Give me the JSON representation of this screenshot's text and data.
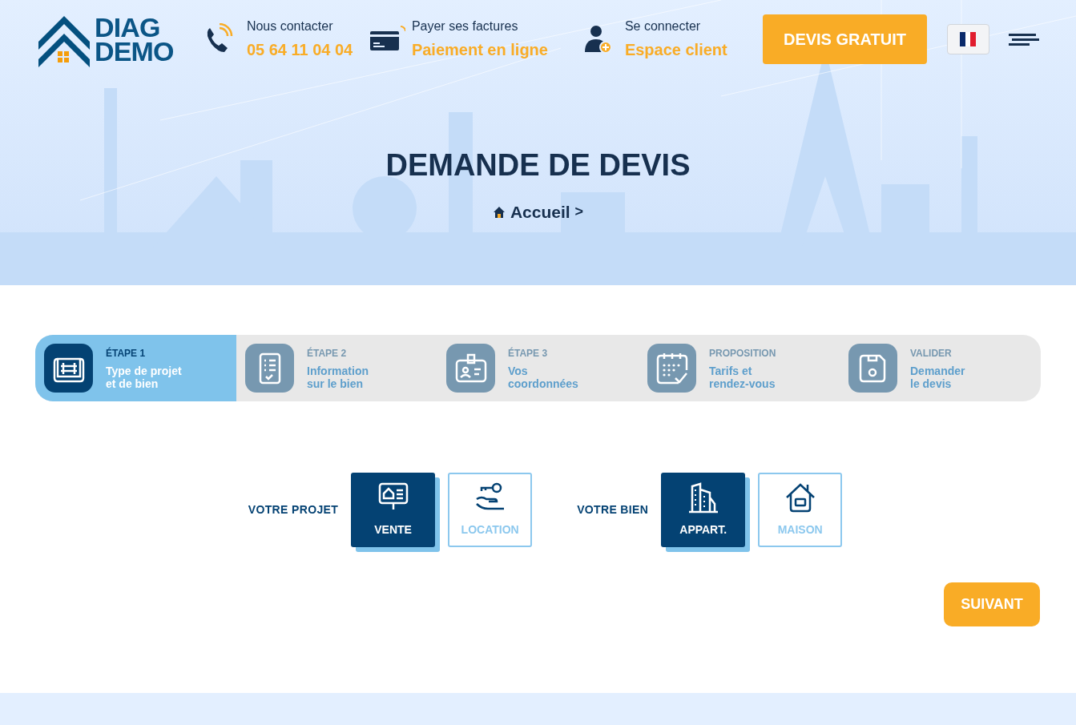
{
  "header": {
    "logo": {
      "line1": "DIAG",
      "line2": "DEMO"
    },
    "contacts": [
      {
        "kind": "phone",
        "label": "Nous contacter",
        "value": "05 64 11 04 04"
      },
      {
        "kind": "card",
        "label": "Payer ses factures",
        "value": "Paiement en ligne"
      },
      {
        "kind": "user",
        "label": "Se connecter",
        "value": "Espace client"
      }
    ],
    "cta": "DEVIS GRATUIT"
  },
  "hero": {
    "title": "DEMANDE DE DEVIS",
    "breadcrumb": [
      "Accueil"
    ],
    "separator": ">"
  },
  "steps": [
    {
      "label": "ÉTAPE 1",
      "title": [
        "Type de projet",
        "et de bien"
      ],
      "selected": true
    },
    {
      "label": "ÉTAPE 2",
      "title": [
        "Information",
        "sur le bien"
      ],
      "selected": false
    },
    {
      "label": "ÉTAPE 3",
      "title": [
        "Vos",
        "coordonnées"
      ],
      "selected": false
    },
    {
      "label": "PROPOSITION",
      "title": [
        "Tarifs et",
        "rendez-vous"
      ],
      "selected": false
    },
    {
      "label": "VALIDER",
      "title": [
        "Demander",
        "le devis"
      ],
      "selected": false
    }
  ],
  "groups": [
    {
      "label": "VOTRE PROJET",
      "options": [
        {
          "label": "VENTE",
          "selected": true
        },
        {
          "label": "LOCATION",
          "selected": false
        }
      ]
    },
    {
      "label": "VOTRE BIEN",
      "options": [
        {
          "label": "APPART.",
          "selected": true
        },
        {
          "label": "MAISON",
          "selected": false
        }
      ]
    }
  ],
  "next_button": "SUIVANT"
}
